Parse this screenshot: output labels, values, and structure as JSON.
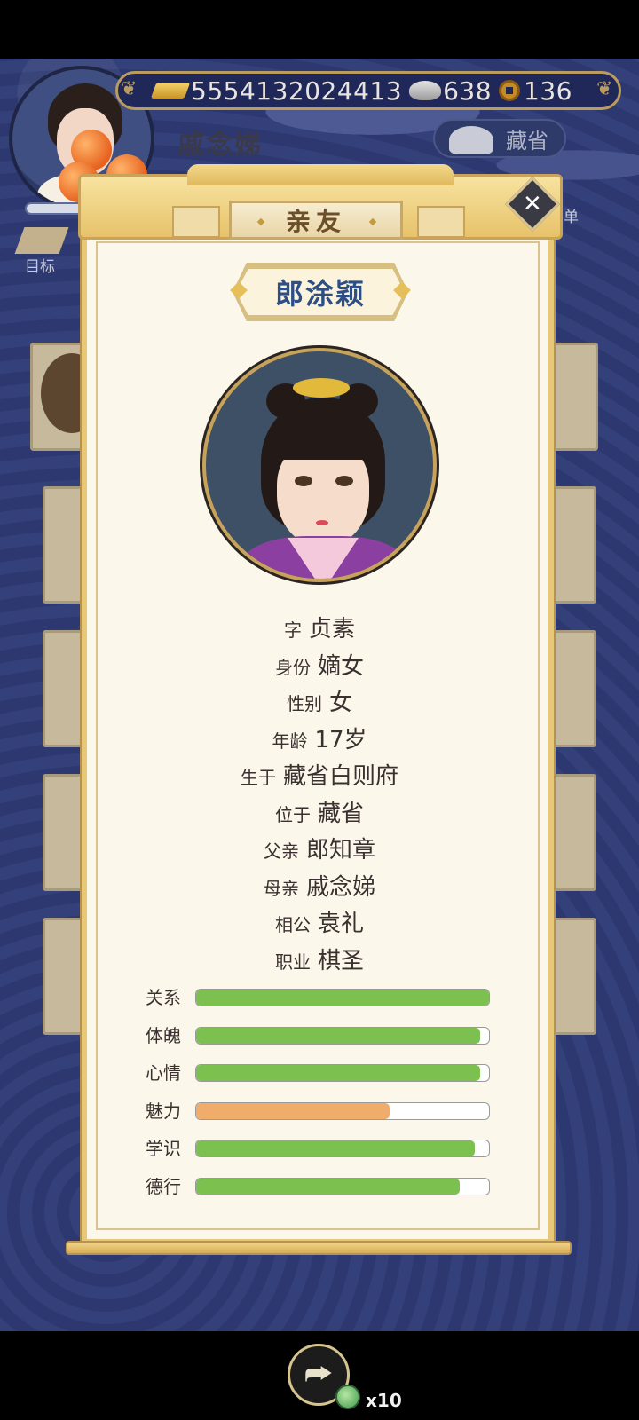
{
  "header": {
    "player_name": "戚念娣",
    "resources": {
      "gold": "5554132024413",
      "silver": "638",
      "coins": "136"
    },
    "region_button": "藏省",
    "goal_label": "目标",
    "menu_label": "菜单"
  },
  "dialog": {
    "title": "亲友",
    "child_name": "郎涂颖",
    "info": [
      {
        "label": "字",
        "value": "贞素"
      },
      {
        "label": "身份",
        "value": "嫡女"
      },
      {
        "label": "性别",
        "value": "女"
      },
      {
        "label": "年龄",
        "value": "17岁"
      },
      {
        "label": "生于",
        "value": "藏省白则府"
      },
      {
        "label": "位于",
        "value": "藏省"
      },
      {
        "label": "父亲",
        "value": "郎知章"
      },
      {
        "label": "母亲",
        "value": "戚念娣"
      },
      {
        "label": "相公",
        "value": "袁礼"
      },
      {
        "label": "职业",
        "value": "棋圣"
      }
    ],
    "stats": [
      {
        "label": "关系",
        "value": 1.0,
        "color": "#7cc04f"
      },
      {
        "label": "体魄",
        "value": 0.97,
        "color": "#7cc04f"
      },
      {
        "label": "心情",
        "value": 0.97,
        "color": "#7cc04f"
      },
      {
        "label": "魅力",
        "value": 0.66,
        "color": "#f0ac6b"
      },
      {
        "label": "学识",
        "value": 0.95,
        "color": "#7cc04f"
      },
      {
        "label": "德行",
        "value": 0.9,
        "color": "#7cc04f"
      }
    ]
  },
  "footer": {
    "reward_count": "x10"
  },
  "icons": {
    "close": "close-icon",
    "share": "share-icon",
    "gold": "gold-ingot-icon",
    "silver": "silver-ingot-icon",
    "coin": "copper-coin-icon"
  }
}
